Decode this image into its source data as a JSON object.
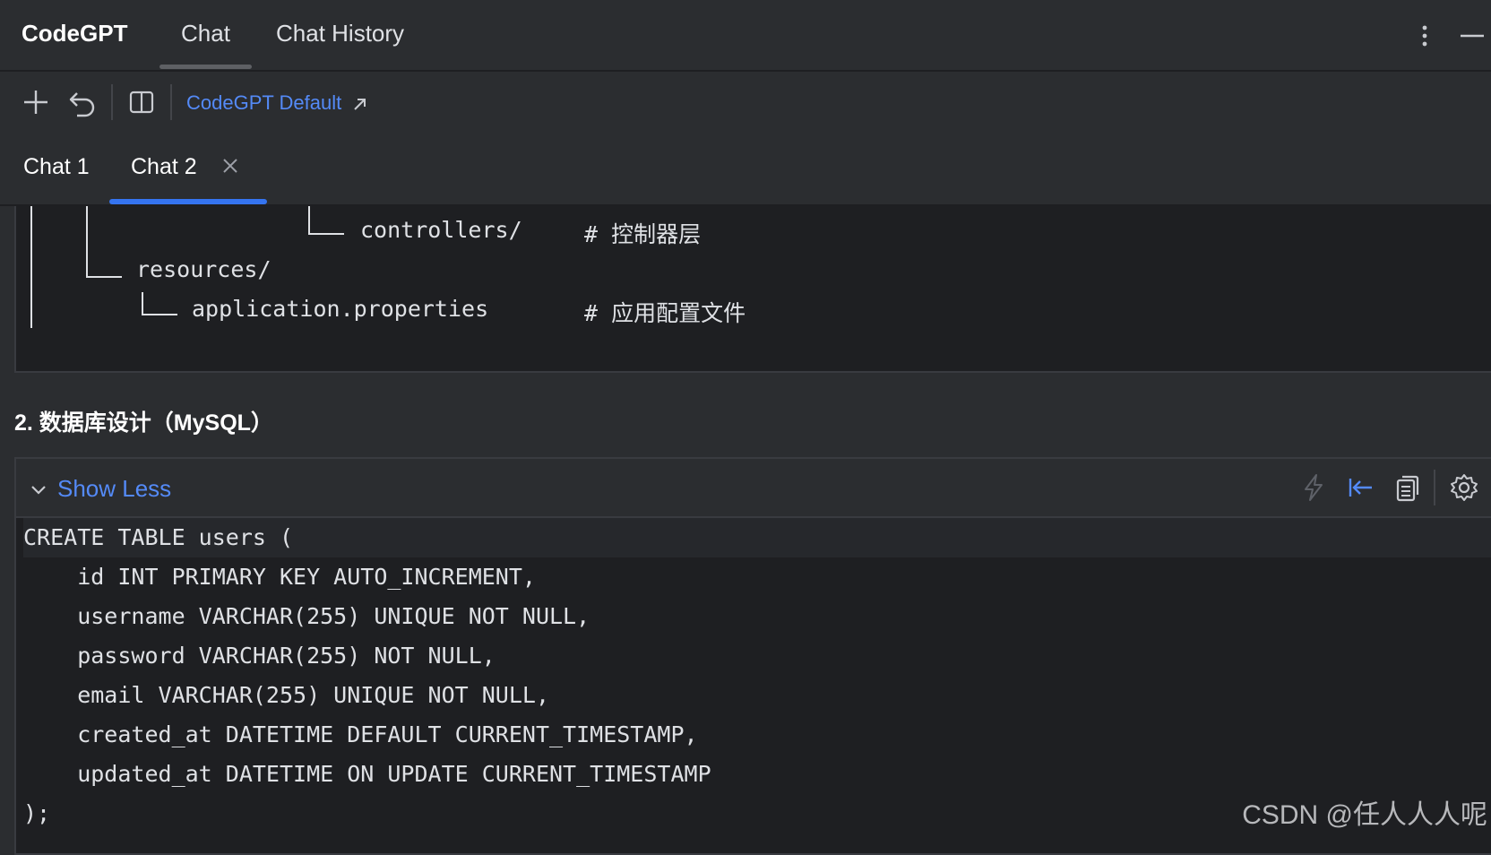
{
  "header": {
    "app_title": "CodeGPT",
    "tabs": [
      {
        "label": "Chat",
        "active": true
      },
      {
        "label": "Chat History",
        "active": false
      }
    ],
    "icons": [
      "more-vertical-icon",
      "minimize-icon"
    ]
  },
  "toolbar": {
    "icons": [
      "plus-icon",
      "undo-icon",
      "split-panel-icon"
    ],
    "model_label": "CodeGPT Default",
    "model_link_icon": "external-link-icon"
  },
  "chat_tabs": [
    {
      "label": "Chat 1",
      "active": false
    },
    {
      "label": "Chat 2",
      "active": true,
      "closable": true
    }
  ],
  "tree": {
    "lines": [
      {
        "name": "controllers/",
        "comment": "# 控制器层"
      },
      {
        "name": "resources/",
        "comment": ""
      },
      {
        "name": "application.properties",
        "comment": "# 应用配置文件"
      }
    ]
  },
  "section": {
    "heading": "2. 数据库设计（MySQL）"
  },
  "code_panel": {
    "toggle_label": "Show Less",
    "icons": [
      "lightning-icon",
      "insert-left-icon",
      "copy-icon",
      "settings-gear-icon"
    ],
    "lines": [
      "CREATE TABLE users (",
      "    id INT PRIMARY KEY AUTO_INCREMENT,",
      "    username VARCHAR(255) UNIQUE NOT NULL,",
      "    password VARCHAR(255) NOT NULL,",
      "    email VARCHAR(255) UNIQUE NOT NULL,",
      "    created_at DATETIME DEFAULT CURRENT_TIMESTAMP,",
      "    updated_at DATETIME ON UPDATE CURRENT_TIMESTAMP",
      ");"
    ]
  },
  "watermark": "CSDN @任人人人呢",
  "colors": {
    "background": "#2b2d30",
    "editor_background": "#1e1f22",
    "accent": "#3574f0",
    "link": "#548af7",
    "text": "#dfe1e5"
  }
}
